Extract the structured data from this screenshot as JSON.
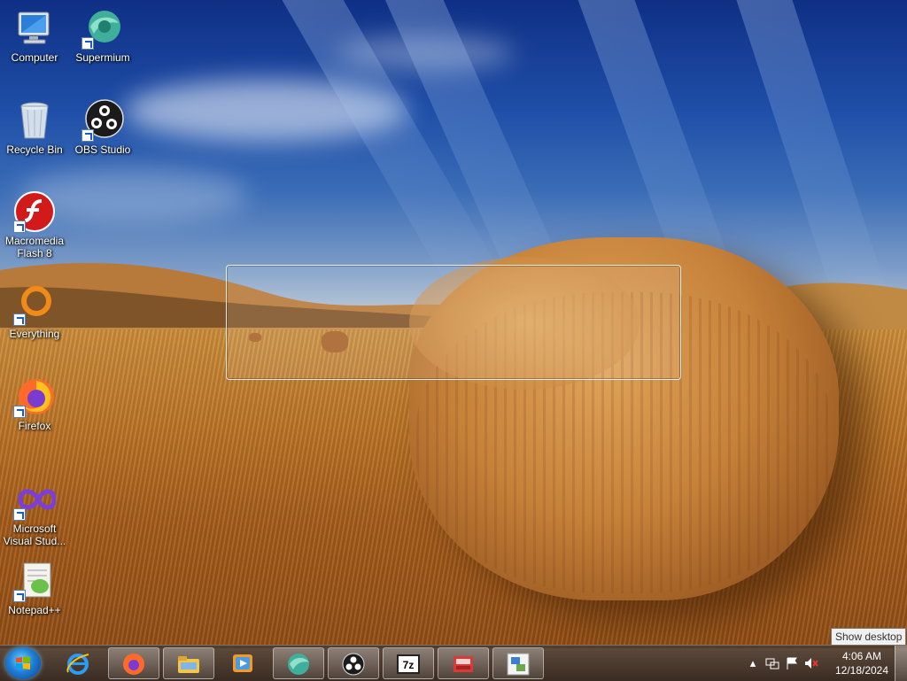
{
  "desktop": {
    "icons": [
      {
        "label": "Computer"
      },
      {
        "label": "Supermium"
      },
      {
        "label": "Recycle Bin"
      },
      {
        "label": "OBS Studio"
      },
      {
        "label": "Macromedia Flash 8"
      },
      {
        "label": "Everything"
      },
      {
        "label": "Firefox"
      },
      {
        "label": "Microsoft Visual Stud..."
      },
      {
        "label": "Notepad++"
      }
    ]
  },
  "taskbar": {
    "start_icon": "windows-start-orb",
    "items": [
      {
        "icon": "internet-explorer-icon",
        "state": "pinned"
      },
      {
        "icon": "firefox-icon",
        "state": "running"
      },
      {
        "icon": "file-explorer-icon",
        "state": "running"
      },
      {
        "icon": "media-player-icon",
        "state": "pinned"
      },
      {
        "icon": "supermium-icon",
        "state": "running"
      },
      {
        "icon": "obs-studio-icon",
        "state": "running"
      },
      {
        "icon": "7zip-icon",
        "state": "running"
      },
      {
        "icon": "red-app-icon",
        "state": "running"
      },
      {
        "icon": "network-app-icon",
        "state": "running"
      }
    ],
    "tray": {
      "icons": [
        "show-hidden-icons-arrow",
        "action-center-flag-icon",
        "network-icon",
        "volume-muted-icon"
      ],
      "time": "4:06 AM",
      "date": "12/18/2024"
    },
    "show_desktop_tooltip": "Show desktop"
  },
  "colors": {
    "sky_top": "#0f2f85",
    "field": "#b87328",
    "taskbar": "#3a2a1f"
  }
}
